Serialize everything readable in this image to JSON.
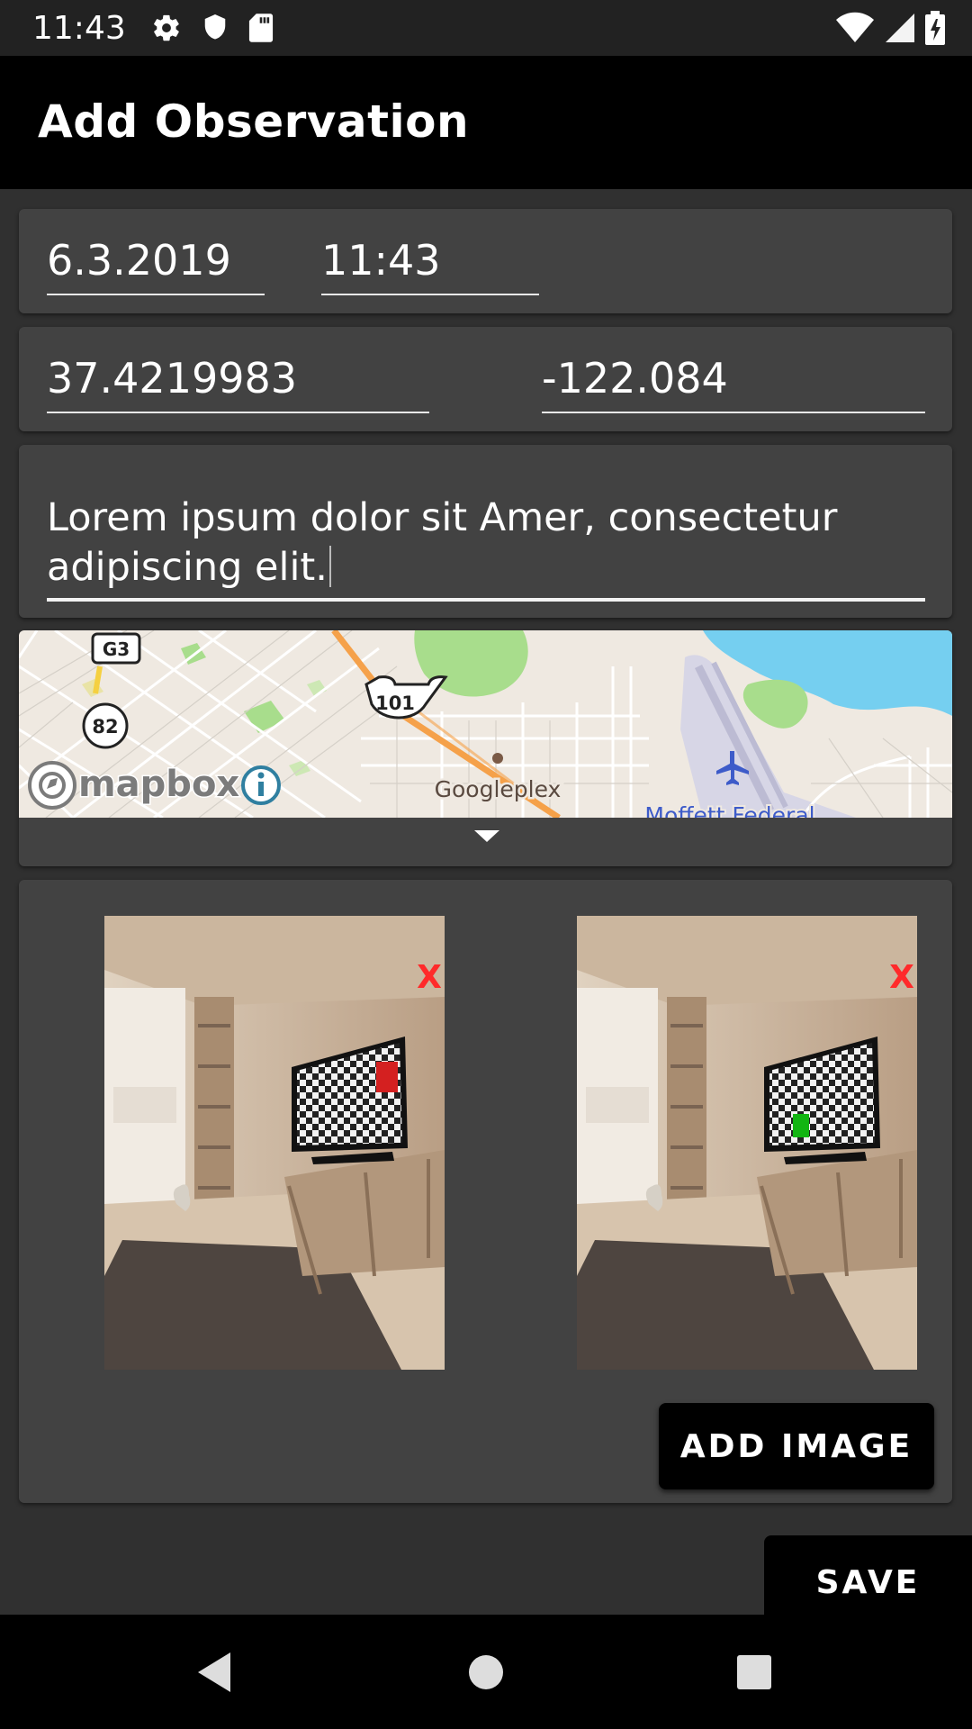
{
  "status_bar": {
    "time": "11:43",
    "left_icons": [
      "settings-icon",
      "shield-icon",
      "sd-card-icon"
    ],
    "right_icons": [
      "wifi-icon",
      "signal-icon",
      "battery-icon"
    ]
  },
  "app_bar": {
    "title": "Add Observation"
  },
  "datetime": {
    "date": "6.3.2019",
    "time": "11:43"
  },
  "location": {
    "latitude": "37.4219983",
    "longitude": "-122.084"
  },
  "description": {
    "text": "Lorem ipsum dolor sit Amer, consectetur adipiscing elit."
  },
  "map": {
    "logo_text": "mapbox",
    "labels": {
      "route_g3": "G3",
      "route_82": "82",
      "route_101": "101",
      "place_googleplex": "Googleplex",
      "place_moffett": "Moffett Federal"
    },
    "colors": {
      "land": "#efe9e1",
      "water": "#75cff0",
      "park": "#a8dd8c",
      "highway": "#f5a14a"
    }
  },
  "images": {
    "items": [
      {
        "remove_label": "X",
        "marker_color": "#d42020"
      },
      {
        "remove_label": "X",
        "marker_color": "#12b512"
      }
    ],
    "add_button_label": "ADD IMAGE"
  },
  "save_label": "SAVE",
  "nav_bar": {
    "icons": [
      "back-icon",
      "home-icon",
      "recents-icon"
    ]
  }
}
